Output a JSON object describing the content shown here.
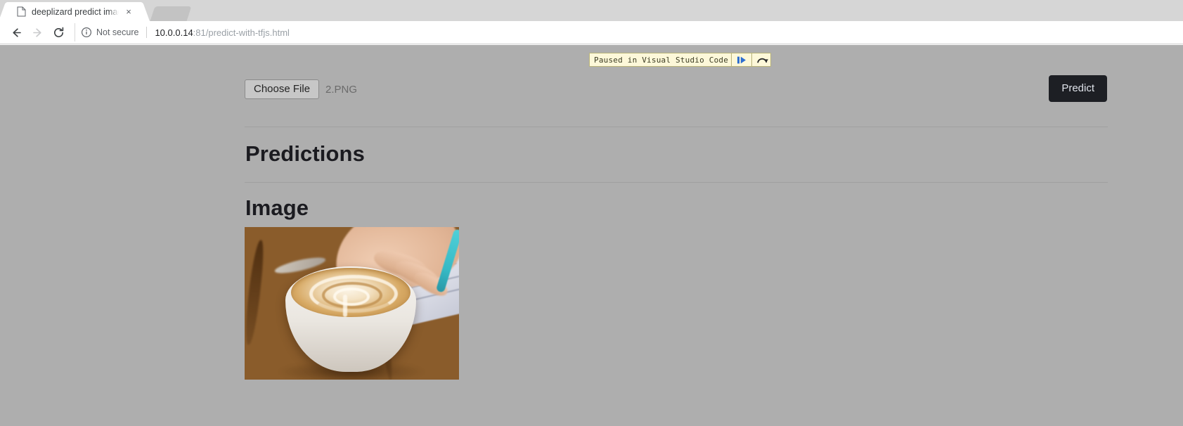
{
  "browser": {
    "tabs": [
      {
        "title": "deeplizard predict image",
        "favicon": "page-icon",
        "close": "×",
        "active": true
      },
      {
        "title": "",
        "favicon": "",
        "close": "",
        "active": false
      }
    ],
    "nav": {
      "back": "back-arrow",
      "forward": "forward-arrow",
      "reload": "reload-arrow"
    },
    "omnibox": {
      "security_icon": "info-circle-icon",
      "security_label": "Not secure",
      "url_host": "10.0.0.14",
      "url_rest": ":81/predict-with-tfjs.html"
    }
  },
  "debugger_banner": {
    "text": "Paused in Visual Studio Code",
    "resume_label": "resume-icon",
    "step_over_label": "step-over-icon",
    "background": "#fdf8d9",
    "border": "#b8b37a",
    "resume_color": "#2f6fd0"
  },
  "page": {
    "background": "#aeaeae",
    "file_input": {
      "button_label": "Choose File",
      "file_name": "2.PNG"
    },
    "predict_button": {
      "label": "Predict",
      "background": "#1d1f24",
      "color": "#dfe3ea"
    },
    "sections": {
      "predictions_title": "Predictions",
      "image_title": "Image"
    },
    "image": {
      "alt": "cappuccino in white cup on wooden table with hand writing",
      "width": "305",
      "height": "217"
    }
  }
}
